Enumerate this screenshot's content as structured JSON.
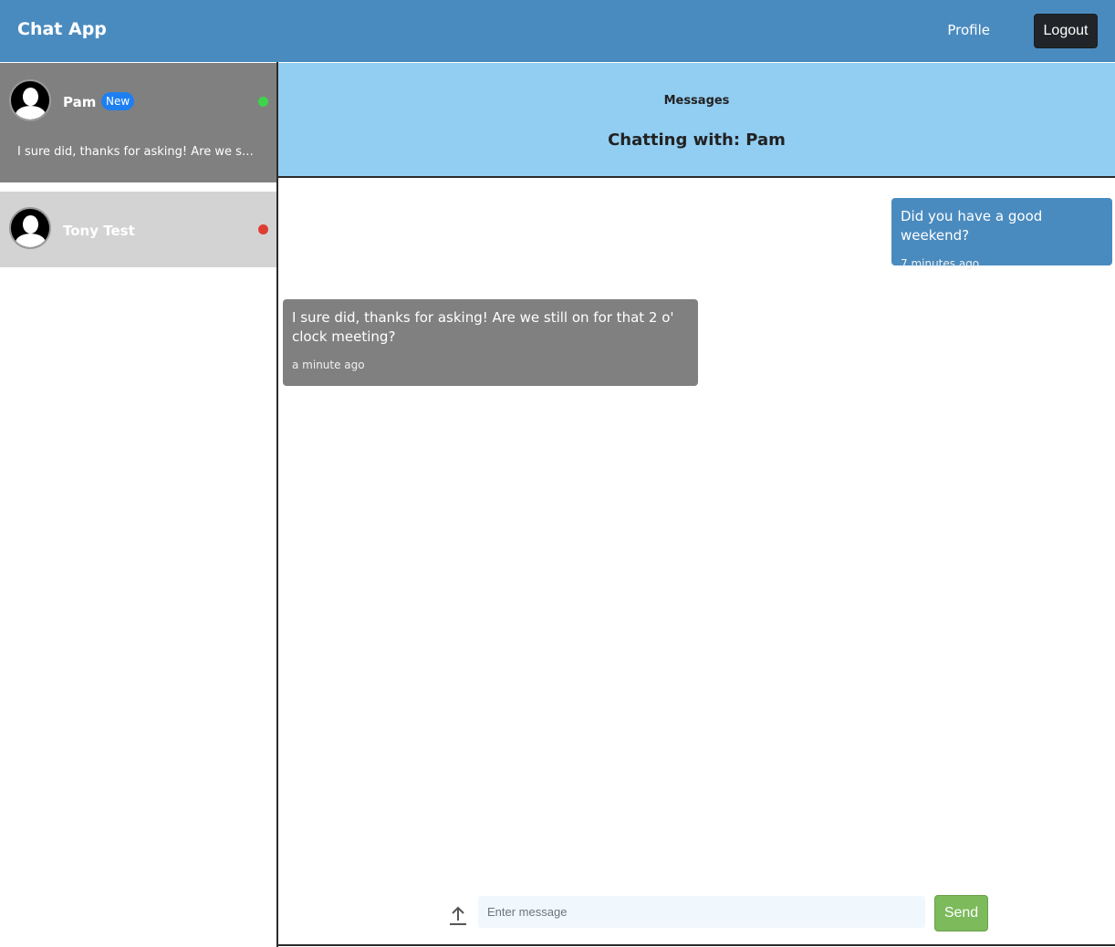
{
  "navbar": {
    "brand": "Chat App",
    "profile_label": "Profile",
    "logout_label": "Logout"
  },
  "contacts": [
    {
      "name": "Pam",
      "badge": "New",
      "preview": "I sure did, thanks for asking! Are we st...",
      "status": "online",
      "status_color": "#3fd44a"
    },
    {
      "name": "Tony Test",
      "status": "offline",
      "status_color": "#e03c31"
    }
  ],
  "chat": {
    "label": "Messages",
    "title": "Chatting with: Pam"
  },
  "messages": [
    {
      "direction": "outgoing",
      "text": "Did you have a good weekend?",
      "time": "7 minutes ago"
    },
    {
      "direction": "incoming",
      "text": "I sure did, thanks for asking! Are we still on for that 2 o' clock meeting?",
      "time": "a minute ago"
    }
  ],
  "composer": {
    "placeholder": "Enter message",
    "send_label": "Send",
    "upload_icon": "upload-arrow-icon"
  },
  "colors": {
    "navbar": "#4a8bbf",
    "header": "#92cef2",
    "send": "#7cba5c"
  }
}
